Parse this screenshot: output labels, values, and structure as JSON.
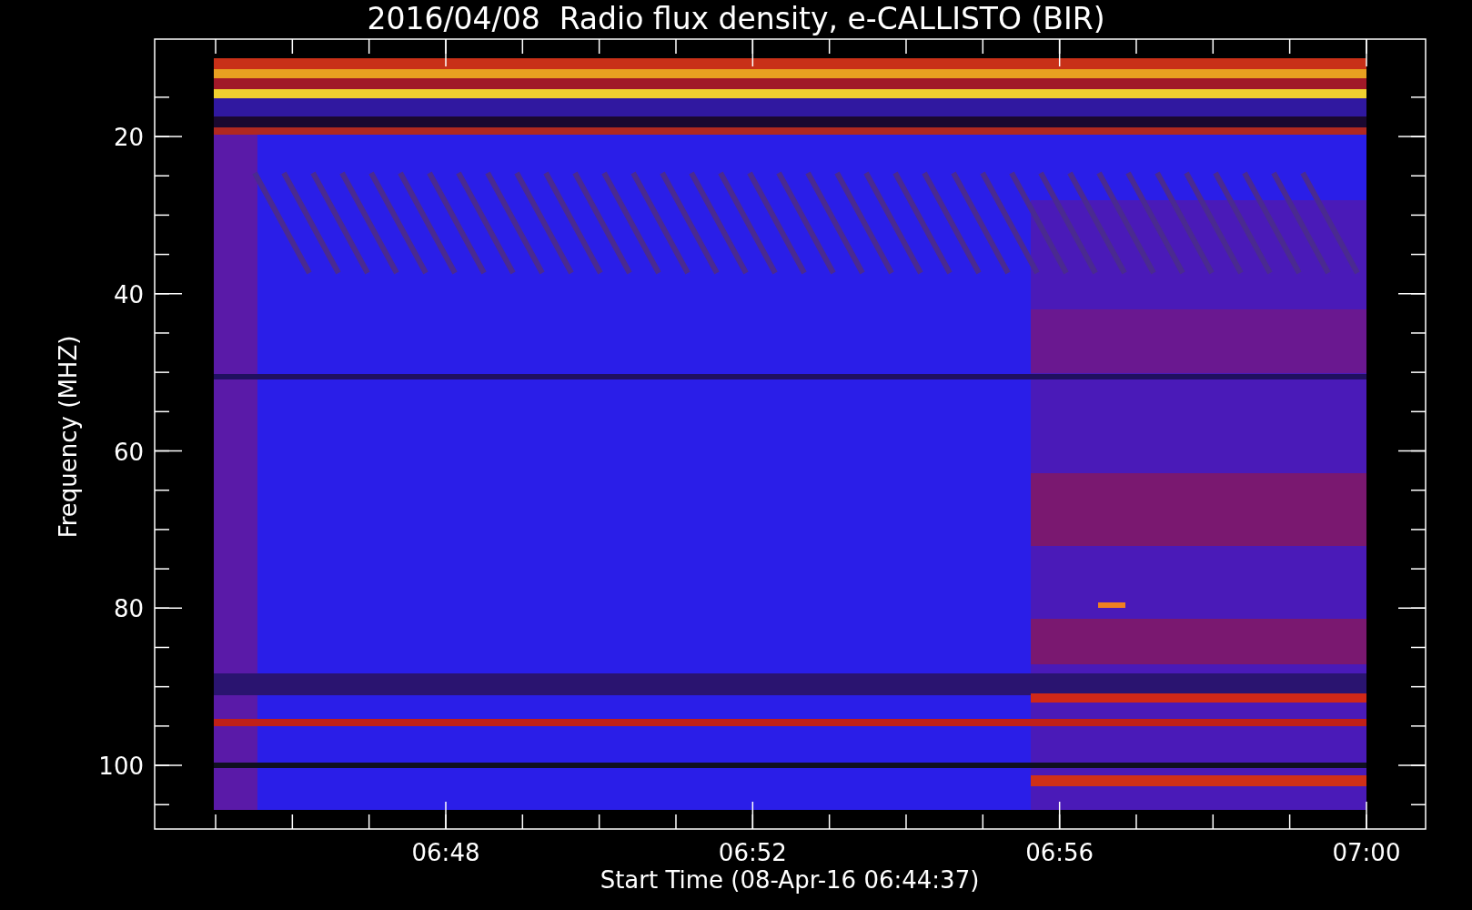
{
  "title": "2016/04/08  Radio flux density, e-CALLISTO (BIR)",
  "ylabel": "Frequency (MHZ)",
  "yticks": [
    "20",
    "40",
    "60",
    "80",
    "100"
  ],
  "xticks": [
    "06:48",
    "06:52",
    "06:56",
    "07:00"
  ],
  "xlabel": "Start Time (08-Apr-16 06:44:37)"
}
